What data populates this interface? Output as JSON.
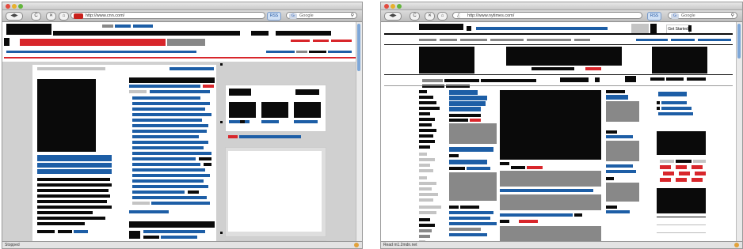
{
  "left_window": {
    "url": "http://www.cnn.com/",
    "search_placeholder": "Google",
    "status": "Stopped",
    "feed_label": "RSS",
    "nav": {
      "back": "◀",
      "forward": "▶",
      "reload": "C",
      "stop": "✕",
      "home": "⌂"
    }
  },
  "right_window": {
    "url": "http://www.nytimes.com/",
    "search_placeholder": "Google",
    "status": "Read m1.2mdn.net",
    "button_label": "Get Started",
    "feed_label": "RSS",
    "nav": {
      "back": "◀",
      "forward": "▶",
      "reload": "C",
      "stop": "✕",
      "home": "⌂"
    }
  },
  "icons": [
    "back-icon",
    "forward-icon",
    "reload-icon",
    "stop-icon",
    "home-icon",
    "search-icon",
    "rss-icon",
    "activity-icon"
  ],
  "colors": {
    "link_blue": "#1d5ea6",
    "accent_red": "#d8262b",
    "redacted_black": "#0a0a0a",
    "chrome_gray": "#d5d5d5"
  }
}
